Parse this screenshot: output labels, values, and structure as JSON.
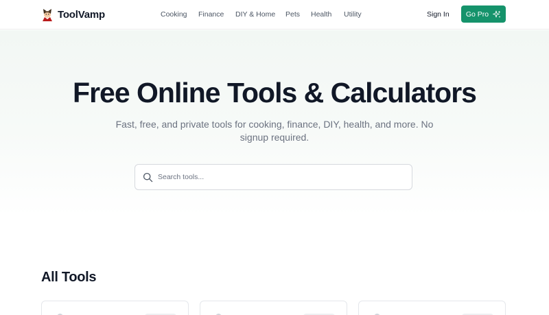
{
  "brand": {
    "name": "ToolVamp",
    "icon": "vampire-icon"
  },
  "nav": [
    {
      "label": "Cooking"
    },
    {
      "label": "Finance"
    },
    {
      "label": "DIY & Home"
    },
    {
      "label": "Pets"
    },
    {
      "label": "Health"
    },
    {
      "label": "Utility"
    }
  ],
  "header": {
    "sign_in": "Sign In",
    "go_pro": "Go Pro",
    "go_pro_icon": "sparkles-icon"
  },
  "hero": {
    "title": "Free Online Tools & Calculators",
    "subtitle": "Fast, free, and private tools for cooking, finance, DIY, health, and more. No signup required.",
    "search_placeholder": "Search tools...",
    "search_value": "",
    "search_icon": "search-icon"
  },
  "tools_section": {
    "title": "All Tools"
  },
  "colors": {
    "accent": "#15936b",
    "hero_bg": "#f2f7f4",
    "text": "#111827",
    "muted": "#6b7280"
  }
}
